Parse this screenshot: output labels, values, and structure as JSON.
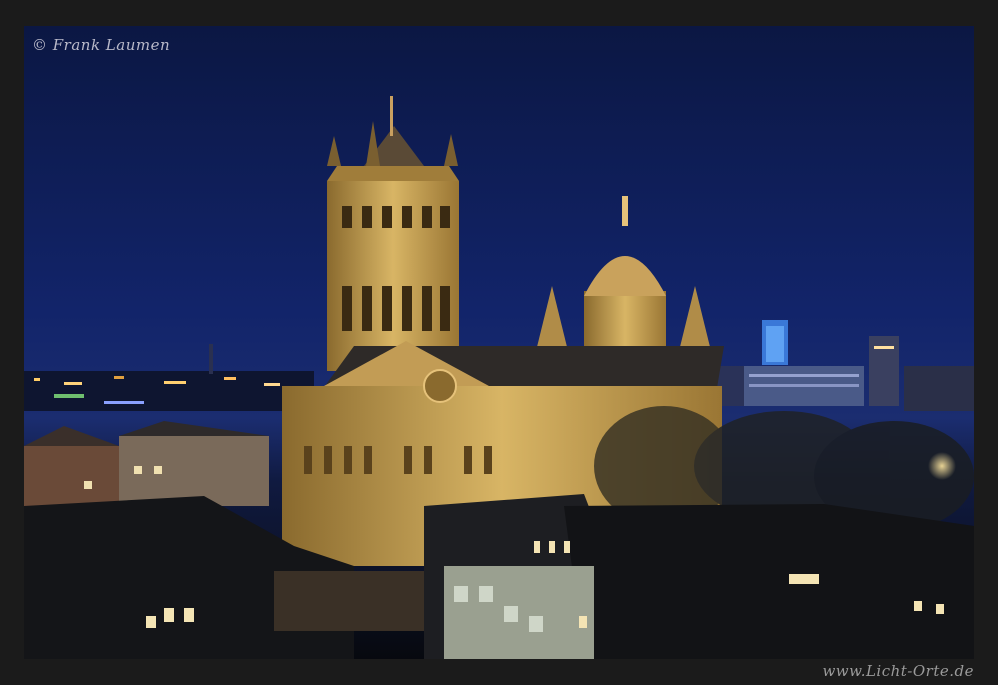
{
  "photo": {
    "subject": "church-night-cityscape"
  },
  "watermark": {
    "copyright": "© Frank Laumen",
    "website": "www.Licht-Orte.de"
  },
  "colors": {
    "sky": "#10215e",
    "stone_lit": "#d6b46a",
    "frame": "#1b1b1b"
  }
}
